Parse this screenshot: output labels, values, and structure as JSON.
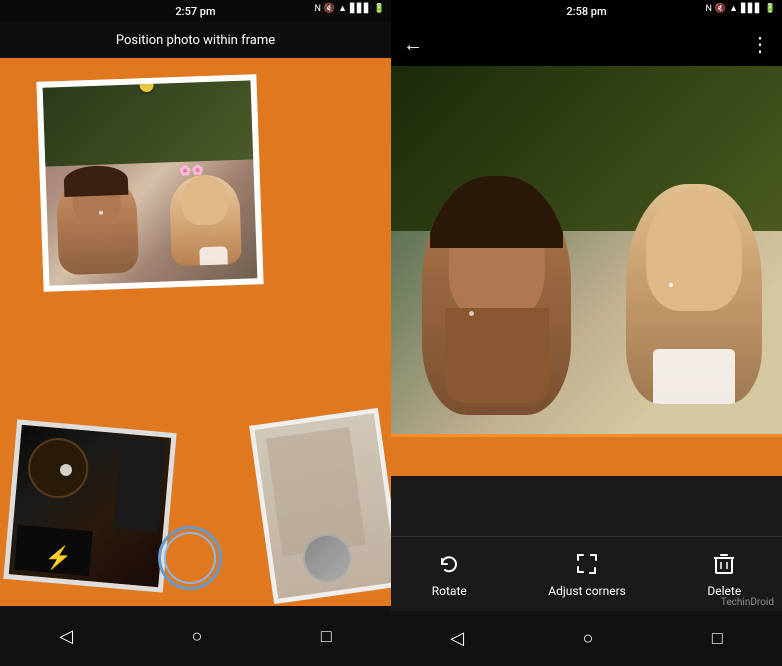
{
  "left": {
    "status_bar": {
      "time": "2:57 pm",
      "icons": [
        "NFC",
        "mute",
        "wifi",
        "signal",
        "battery"
      ]
    },
    "instruction": "Position photo within frame",
    "camera_controls": {
      "flash_icon": "⚡",
      "shutter_label": "shutter"
    },
    "nav": {
      "back": "◁",
      "home": "○",
      "recent": "□"
    }
  },
  "right": {
    "status_bar": {
      "time": "2:58 pm",
      "icons": [
        "NFC",
        "mute",
        "wifi",
        "signal",
        "battery"
      ]
    },
    "top_bar": {
      "back_icon": "←",
      "more_icon": "⋮"
    },
    "tools": [
      {
        "id": "rotate",
        "label": "Rotate",
        "icon": "rotate"
      },
      {
        "id": "adjust-corners",
        "label": "Adjust corners",
        "icon": "corners"
      },
      {
        "id": "delete",
        "label": "Delete",
        "icon": "trash"
      }
    ],
    "nav": {
      "back": "◁",
      "home": "○",
      "recent": "□"
    },
    "watermark": "TechinDroid"
  }
}
